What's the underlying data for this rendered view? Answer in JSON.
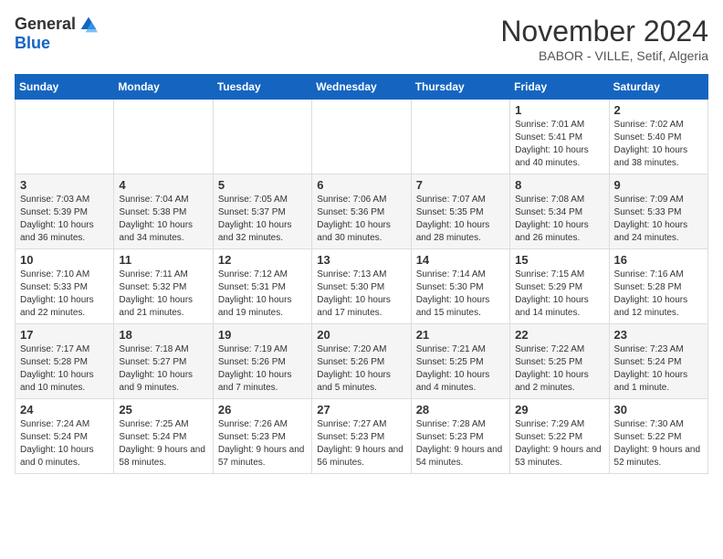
{
  "logo": {
    "general": "General",
    "blue": "Blue"
  },
  "header": {
    "month_year": "November 2024",
    "location": "BABOR - VILLE, Setif, Algeria"
  },
  "weekdays": [
    "Sunday",
    "Monday",
    "Tuesday",
    "Wednesday",
    "Thursday",
    "Friday",
    "Saturday"
  ],
  "weeks": [
    [
      {
        "day": "",
        "info": ""
      },
      {
        "day": "",
        "info": ""
      },
      {
        "day": "",
        "info": ""
      },
      {
        "day": "",
        "info": ""
      },
      {
        "day": "",
        "info": ""
      },
      {
        "day": "1",
        "info": "Sunrise: 7:01 AM\nSunset: 5:41 PM\nDaylight: 10 hours and 40 minutes."
      },
      {
        "day": "2",
        "info": "Sunrise: 7:02 AM\nSunset: 5:40 PM\nDaylight: 10 hours and 38 minutes."
      }
    ],
    [
      {
        "day": "3",
        "info": "Sunrise: 7:03 AM\nSunset: 5:39 PM\nDaylight: 10 hours and 36 minutes."
      },
      {
        "day": "4",
        "info": "Sunrise: 7:04 AM\nSunset: 5:38 PM\nDaylight: 10 hours and 34 minutes."
      },
      {
        "day": "5",
        "info": "Sunrise: 7:05 AM\nSunset: 5:37 PM\nDaylight: 10 hours and 32 minutes."
      },
      {
        "day": "6",
        "info": "Sunrise: 7:06 AM\nSunset: 5:36 PM\nDaylight: 10 hours and 30 minutes."
      },
      {
        "day": "7",
        "info": "Sunrise: 7:07 AM\nSunset: 5:35 PM\nDaylight: 10 hours and 28 minutes."
      },
      {
        "day": "8",
        "info": "Sunrise: 7:08 AM\nSunset: 5:34 PM\nDaylight: 10 hours and 26 minutes."
      },
      {
        "day": "9",
        "info": "Sunrise: 7:09 AM\nSunset: 5:33 PM\nDaylight: 10 hours and 24 minutes."
      }
    ],
    [
      {
        "day": "10",
        "info": "Sunrise: 7:10 AM\nSunset: 5:33 PM\nDaylight: 10 hours and 22 minutes."
      },
      {
        "day": "11",
        "info": "Sunrise: 7:11 AM\nSunset: 5:32 PM\nDaylight: 10 hours and 21 minutes."
      },
      {
        "day": "12",
        "info": "Sunrise: 7:12 AM\nSunset: 5:31 PM\nDaylight: 10 hours and 19 minutes."
      },
      {
        "day": "13",
        "info": "Sunrise: 7:13 AM\nSunset: 5:30 PM\nDaylight: 10 hours and 17 minutes."
      },
      {
        "day": "14",
        "info": "Sunrise: 7:14 AM\nSunset: 5:30 PM\nDaylight: 10 hours and 15 minutes."
      },
      {
        "day": "15",
        "info": "Sunrise: 7:15 AM\nSunset: 5:29 PM\nDaylight: 10 hours and 14 minutes."
      },
      {
        "day": "16",
        "info": "Sunrise: 7:16 AM\nSunset: 5:28 PM\nDaylight: 10 hours and 12 minutes."
      }
    ],
    [
      {
        "day": "17",
        "info": "Sunrise: 7:17 AM\nSunset: 5:28 PM\nDaylight: 10 hours and 10 minutes."
      },
      {
        "day": "18",
        "info": "Sunrise: 7:18 AM\nSunset: 5:27 PM\nDaylight: 10 hours and 9 minutes."
      },
      {
        "day": "19",
        "info": "Sunrise: 7:19 AM\nSunset: 5:26 PM\nDaylight: 10 hours and 7 minutes."
      },
      {
        "day": "20",
        "info": "Sunrise: 7:20 AM\nSunset: 5:26 PM\nDaylight: 10 hours and 5 minutes."
      },
      {
        "day": "21",
        "info": "Sunrise: 7:21 AM\nSunset: 5:25 PM\nDaylight: 10 hours and 4 minutes."
      },
      {
        "day": "22",
        "info": "Sunrise: 7:22 AM\nSunset: 5:25 PM\nDaylight: 10 hours and 2 minutes."
      },
      {
        "day": "23",
        "info": "Sunrise: 7:23 AM\nSunset: 5:24 PM\nDaylight: 10 hours and 1 minute."
      }
    ],
    [
      {
        "day": "24",
        "info": "Sunrise: 7:24 AM\nSunset: 5:24 PM\nDaylight: 10 hours and 0 minutes."
      },
      {
        "day": "25",
        "info": "Sunrise: 7:25 AM\nSunset: 5:24 PM\nDaylight: 9 hours and 58 minutes."
      },
      {
        "day": "26",
        "info": "Sunrise: 7:26 AM\nSunset: 5:23 PM\nDaylight: 9 hours and 57 minutes."
      },
      {
        "day": "27",
        "info": "Sunrise: 7:27 AM\nSunset: 5:23 PM\nDaylight: 9 hours and 56 minutes."
      },
      {
        "day": "28",
        "info": "Sunrise: 7:28 AM\nSunset: 5:23 PM\nDaylight: 9 hours and 54 minutes."
      },
      {
        "day": "29",
        "info": "Sunrise: 7:29 AM\nSunset: 5:22 PM\nDaylight: 9 hours and 53 minutes."
      },
      {
        "day": "30",
        "info": "Sunrise: 7:30 AM\nSunset: 5:22 PM\nDaylight: 9 hours and 52 minutes."
      }
    ]
  ]
}
